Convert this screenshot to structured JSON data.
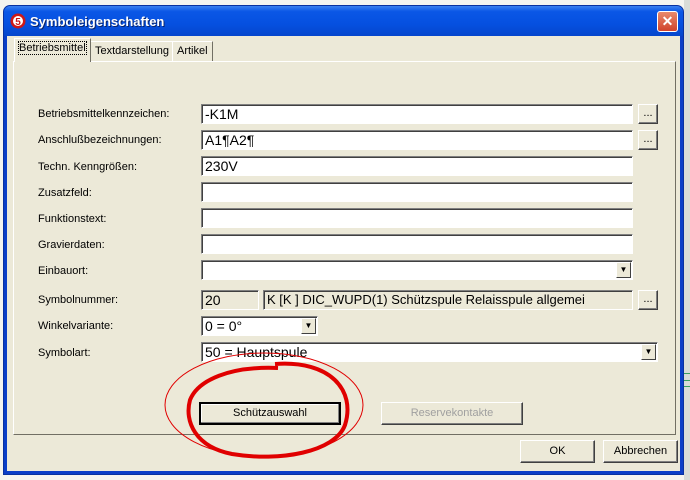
{
  "window": {
    "title": "Symboleigenschaften",
    "close_glyph": "✕",
    "app_icon": "eplan-app-icon"
  },
  "tabs": [
    {
      "label": "Betriebsmittel",
      "active": true
    },
    {
      "label": "Textdarstellung",
      "active": false
    },
    {
      "label": "Artikel",
      "active": false
    }
  ],
  "form": {
    "betriebsmittelkennzeichen": {
      "label": "Betriebsmittelkennzeichen:",
      "value": "-K1M",
      "button": "..."
    },
    "anschlussbezeichnungen": {
      "label": "Anschlußbezeichnungen:",
      "value": "A1¶A2¶",
      "button": "..."
    },
    "techn_kenngroessen": {
      "label": "Techn. Kenngrößen:",
      "value": "230V"
    },
    "zusatzfeld": {
      "label": "Zusatzfeld:",
      "value": ""
    },
    "funktionstext": {
      "label": "Funktionstext:",
      "value": ""
    },
    "gravierdaten": {
      "label": "Gravierdaten:",
      "value": ""
    },
    "einbauort": {
      "label": "Einbauort:",
      "value": ""
    },
    "symbolnummer": {
      "label": "Symbolnummer:",
      "number": "20",
      "description": "K [K  ] DIC_WUPD(1) Schützspule Relaisspule allgemei",
      "button": "..."
    },
    "winkelvariante": {
      "label": "Winkelvariante:",
      "value": "0 = 0°"
    },
    "symbolart": {
      "label": "Symbolart:",
      "value": "50 = Hauptspule"
    }
  },
  "buttons": {
    "schuetzauswahl": "Schützauswahl",
    "reservekontakte": "Reservekontakte",
    "ok": "OK",
    "abbrechen": "Abbrechen"
  },
  "dropdown_arrow": "▼",
  "annotation": {
    "color": "#e00000"
  }
}
